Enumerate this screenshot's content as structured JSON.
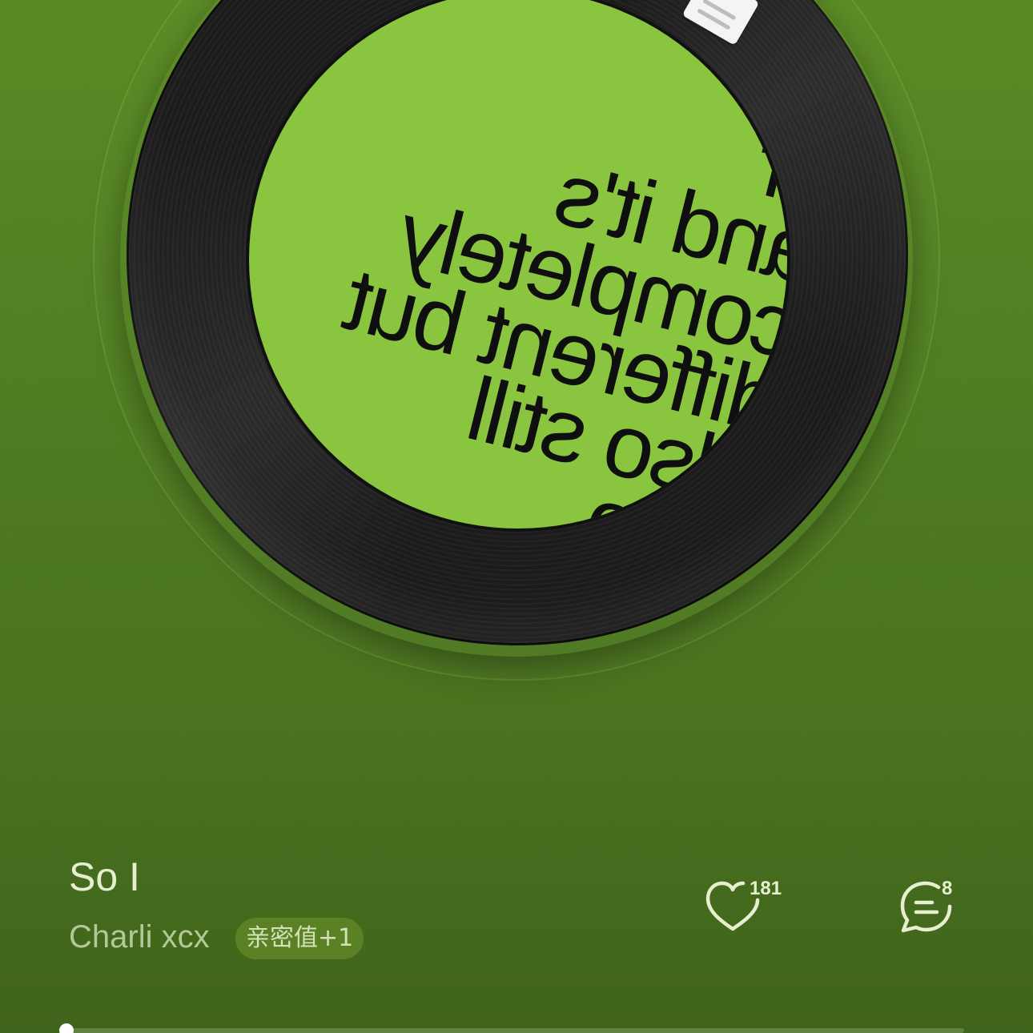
{
  "album_cover": {
    "lines": [
      "ur",
      "and it's",
      "completely",
      "different but",
      "also still",
      "also"
    ]
  },
  "song": {
    "title": "So I",
    "artist": "Charli xcx",
    "intimacy_badge": "亲密值+1"
  },
  "actions": {
    "like_count": "181",
    "comment_count": "8"
  },
  "playback": {
    "progress": 0.0
  },
  "colors": {
    "background": "#507e22",
    "cover": "#8ac53f",
    "text_primary": "#e6efcf",
    "text_secondary": "#b2c997"
  },
  "icons": [
    "heart-icon",
    "comment-icon"
  ]
}
